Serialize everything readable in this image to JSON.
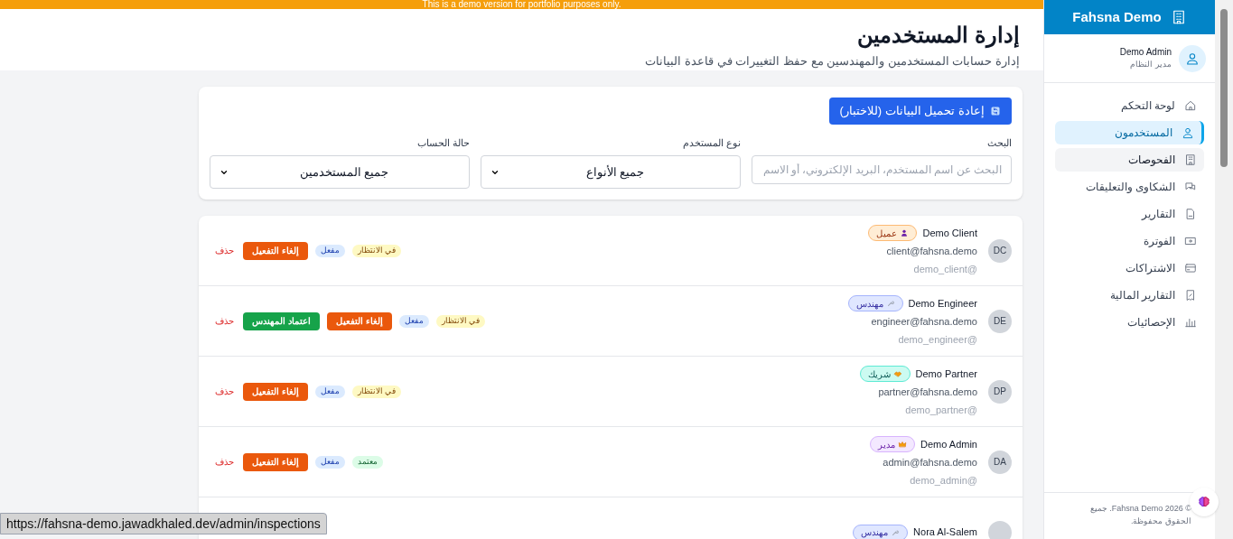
{
  "banner": {
    "text": "This is a demo version for portfolio purposes only."
  },
  "sidebar": {
    "brand": "Fahsna Demo",
    "user": {
      "name": "Demo Admin",
      "role": "مدير النظام"
    },
    "items": [
      {
        "label": "لوحة التحكم",
        "selected": false,
        "hovered": false
      },
      {
        "label": "المستخدمون",
        "selected": true,
        "hovered": false
      },
      {
        "label": "الفحوصات",
        "selected": false,
        "hovered": true
      },
      {
        "label": "الشكاوى والتعليقات",
        "selected": false,
        "hovered": false
      },
      {
        "label": "التقارير",
        "selected": false,
        "hovered": false
      },
      {
        "label": "الفوترة",
        "selected": false,
        "hovered": false
      },
      {
        "label": "الاشتراكات",
        "selected": false,
        "hovered": false
      },
      {
        "label": "التقارير المالية",
        "selected": false,
        "hovered": false
      },
      {
        "label": "الإحصائيات",
        "selected": false,
        "hovered": false
      }
    ],
    "footer": "© Fahsna Demo 2026. جميع الحقوق محفوظة."
  },
  "header": {
    "title": "إدارة المستخدمين",
    "subtitle": "إدارة حسابات المستخدمين والمهندسين مع حفظ التغييرات في قاعدة البيانات"
  },
  "filters": {
    "reload_button": "إعادة تحميل البيانات (للاختبار)",
    "search": {
      "label": "البحث",
      "placeholder": "البحث عن اسم المستخدم، البريد الإلكتروني، أو الاسم"
    },
    "user_type": {
      "label": "نوع المستخدم",
      "value": "جميع الأنواع"
    },
    "account_status": {
      "label": "حالة الحساب",
      "value": "جميع المستخدمين"
    }
  },
  "users": [
    {
      "initials": "DC",
      "name": "Demo Client",
      "role": {
        "kind": "client",
        "label": "عميل"
      },
      "email": "client@fahsna.demo",
      "username": "demo_client@",
      "statuses": [
        {
          "kind": "pending",
          "label": "في الانتظار"
        },
        {
          "kind": "active",
          "label": "مفعل"
        }
      ],
      "actions": [
        {
          "kind": "deactivate",
          "label": "إلغاء التفعيل"
        },
        {
          "kind": "delete",
          "label": "حذف"
        }
      ]
    },
    {
      "initials": "DE",
      "name": "Demo Engineer",
      "role": {
        "kind": "engineer",
        "label": "مهندس"
      },
      "email": "engineer@fahsna.demo",
      "username": "demo_engineer@",
      "statuses": [
        {
          "kind": "pending",
          "label": "في الانتظار"
        },
        {
          "kind": "active",
          "label": "مفعل"
        }
      ],
      "actions": [
        {
          "kind": "deactivate",
          "label": "إلغاء التفعيل"
        },
        {
          "kind": "approve",
          "label": "اعتماد المهندس"
        },
        {
          "kind": "delete",
          "label": "حذف"
        }
      ]
    },
    {
      "initials": "DP",
      "name": "Demo Partner",
      "role": {
        "kind": "partner",
        "label": "شريك"
      },
      "email": "partner@fahsna.demo",
      "username": "demo_partner@",
      "statuses": [
        {
          "kind": "pending",
          "label": "في الانتظار"
        },
        {
          "kind": "active",
          "label": "مفعل"
        }
      ],
      "actions": [
        {
          "kind": "deactivate",
          "label": "إلغاء التفعيل"
        },
        {
          "kind": "delete",
          "label": "حذف"
        }
      ]
    },
    {
      "initials": "DA",
      "name": "Demo Admin",
      "role": {
        "kind": "admin",
        "label": "مدير"
      },
      "email": "admin@fahsna.demo",
      "username": "demo_admin@",
      "statuses": [
        {
          "kind": "approved",
          "label": "معتمد"
        },
        {
          "kind": "active",
          "label": "مفعل"
        }
      ],
      "actions": [
        {
          "kind": "deactivate",
          "label": "إلغاء التفعيل"
        },
        {
          "kind": "delete",
          "label": "حذف"
        }
      ]
    },
    {
      "name": "Nora Al-Salem",
      "role": {
        "kind": "engineer",
        "label": "مهندس"
      }
    }
  ],
  "status_url": "https://fahsna-demo.jawadkhaled.dev/admin/inspections"
}
